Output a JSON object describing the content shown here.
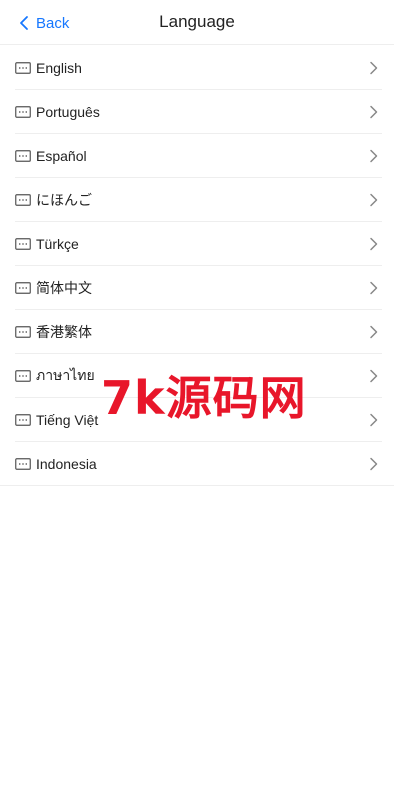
{
  "header": {
    "back_label": "Back",
    "title": "Language"
  },
  "languages": [
    {
      "label": "English"
    },
    {
      "label": "Português"
    },
    {
      "label": "Español"
    },
    {
      "label": "にほんご"
    },
    {
      "label": "Türkçe"
    },
    {
      "label": "简体中文"
    },
    {
      "label": "香港繁体"
    },
    {
      "label": "ภาษาไทย"
    },
    {
      "label": "Tiếng Việt"
    },
    {
      "label": "Indonesia"
    }
  ],
  "watermark": "7k源码网",
  "colors": {
    "accent": "#1677ff",
    "watermark": "#e8162a",
    "divider": "#eeeeee"
  }
}
